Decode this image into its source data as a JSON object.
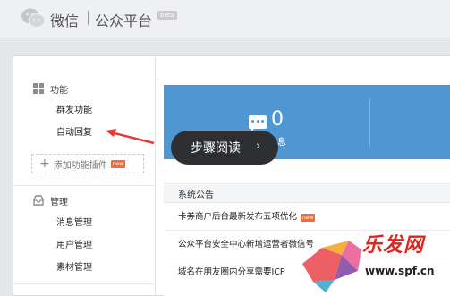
{
  "header": {
    "brand": "微信",
    "product": "公众平台",
    "beta": "beta"
  },
  "sidebar": {
    "section_function": "功能",
    "function_items": [
      "群发功能",
      "自动回复"
    ],
    "add_plugin": "添加功能插件",
    "new_badge": "new",
    "section_manage": "管理",
    "manage_items": [
      "消息管理",
      "用户管理",
      "素材管理"
    ]
  },
  "banner": {
    "message_count": "0",
    "message_label_partial": "息"
  },
  "notice": {
    "title": "系统公告",
    "rows": [
      {
        "text": "卡券商户后台最新发布五项优化",
        "badge": "new"
      },
      {
        "text": "公众平台安全中心新增运营者微信号",
        "badge": ""
      },
      {
        "text": "域名在朋友圈内分享需要ICP",
        "badge": ""
      }
    ]
  },
  "tooltip": {
    "text": "步骤阅读",
    "chevron": "›"
  },
  "watermark": {
    "text": "乐发网",
    "url": "www.spf.cn"
  },
  "colors": {
    "banner": "#4f97d2",
    "arrow": "#e23a3a",
    "new_badge": "#f56a36"
  },
  "icons": [
    "wechat-logo-icon",
    "grid-icon",
    "inbox-icon",
    "message-icon",
    "plus-icon",
    "chevron-right-icon"
  ]
}
